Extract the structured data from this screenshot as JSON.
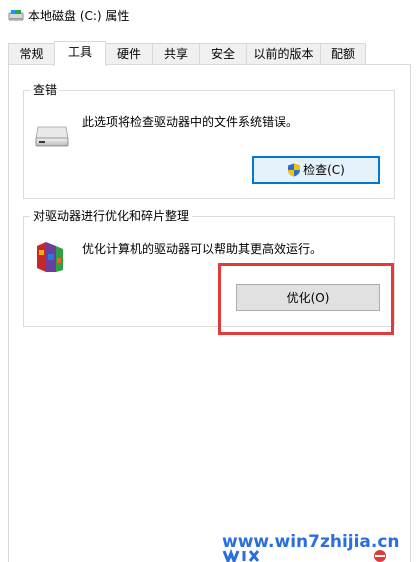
{
  "window": {
    "title": "本地磁盘 (C:) 属性"
  },
  "tabs": [
    {
      "label": "常规",
      "active": false
    },
    {
      "label": "工具",
      "active": true
    },
    {
      "label": "硬件",
      "active": false
    },
    {
      "label": "共享",
      "active": false
    },
    {
      "label": "安全",
      "active": false
    },
    {
      "label": "以前的版本",
      "active": false
    },
    {
      "label": "配额",
      "active": false
    }
  ],
  "error_checking": {
    "title": "查错",
    "description": "此选项将检查驱动器中的文件系统错误。",
    "button_label": "检查(C)",
    "icon": "drive-icon"
  },
  "optimize": {
    "title": "对驱动器进行优化和碎片整理",
    "description": "优化计算机的驱动器可以帮助其更高效运行。",
    "button_label": "优化(O)",
    "icon": "defrag-icon"
  },
  "watermark": {
    "text": "www.win7zhijia.cn"
  },
  "colors": {
    "highlight_box": "#e23a3a",
    "focus_border": "#0078d7",
    "watermark": "#2b6ee0"
  }
}
